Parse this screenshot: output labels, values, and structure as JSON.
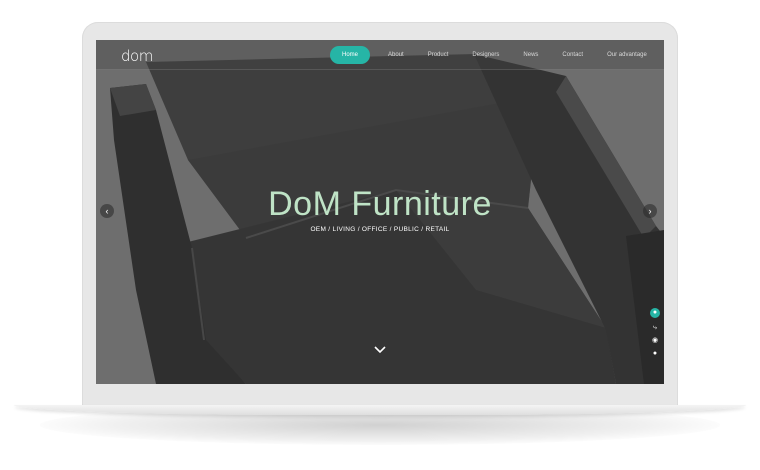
{
  "site": {
    "logo_text": "dom",
    "accent_color": "#26b5a6"
  },
  "nav": {
    "items": [
      {
        "label": "Home",
        "active": true
      },
      {
        "label": "About"
      },
      {
        "label": "Product"
      },
      {
        "label": "Designers"
      },
      {
        "label": "News"
      },
      {
        "label": "Contact"
      },
      {
        "label": "Our advantage"
      }
    ]
  },
  "hero": {
    "title": "DoM Furniture",
    "subtitle": "OEM / LIVING / OFFICE / PUBLIC / RETAIL"
  },
  "controls": {
    "prev_icon": "chevron-left-icon",
    "next_icon": "chevron-right-icon",
    "scroll_icon": "chevron-down-icon"
  },
  "side_buttons": [
    "qq-icon",
    "share-icon",
    "weibo-icon",
    "wechat-icon"
  ]
}
